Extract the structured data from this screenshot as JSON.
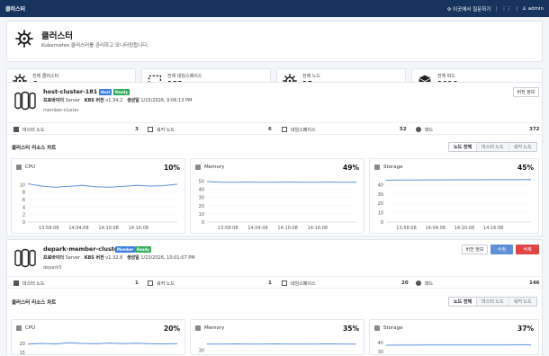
{
  "topbar": {
    "title": "클러스터",
    "help": "이곳에서 질문하기",
    "user": "admin"
  },
  "header": {
    "title": "클러스터",
    "subtitle": "Kubernetes 클러스터를 관리하고 모니터링합니다."
  },
  "stats": [
    {
      "label": "전체 클러스터",
      "value": "6",
      "icon": "helm-wheel-icon"
    },
    {
      "label": "전체 네임스페이스",
      "value": "133",
      "icon": "namespace-dashed-box-icon"
    },
    {
      "label": "전체 노드",
      "value": "15",
      "icon": "node-wheel-icon"
    },
    {
      "label": "전체 파드",
      "value": "1096",
      "icon": "pod-cube-icon"
    }
  ],
  "colors": {
    "topbar": "#17345f",
    "line": "#5b93d9",
    "host_badge": "#3b7ddd",
    "ready_badge": "#2fae5b",
    "member_badge": "#3b7ddd",
    "delete": "#e04545",
    "edit": "#5f8fd8"
  },
  "resource_labels": {
    "master": "마스터 노드",
    "worker": "워커 노드",
    "namespace": "네임스페이스",
    "pod": "파드"
  },
  "chart_section_title": "클러스터 리소스 차트",
  "chart_tabs": [
    "노드 전체",
    "마스터 노드",
    "워커 노드"
  ],
  "metric_labels": {
    "cpu": "CPU",
    "memory": "Memory",
    "storage": "Storage"
  },
  "clusters": [
    {
      "name": "host-cluster-181",
      "badges": [
        "Host",
        "Ready"
      ],
      "provider_label": "프로바이더",
      "provider": "Server",
      "version_label": "K8S 버전",
      "version": "v1.34.2",
      "created_label": "생성일",
      "created": "1/15/2026, 9:06:13 PM",
      "type": "member-cluster",
      "buttons": [
        "버전 정보"
      ],
      "resources": {
        "master": "3",
        "worker": "6",
        "namespace": "52",
        "pod": "372"
      },
      "cpu_pct": "10%",
      "mem_pct": "49%",
      "storage_pct": "45%"
    },
    {
      "name": "depark-member-cluster",
      "badges": [
        "Member",
        "Ready"
      ],
      "provider_label": "프로바이더",
      "provider": "Server",
      "version_label": "K8S 버전",
      "version": "v1.32.8",
      "created_label": "생성일",
      "created": "1/23/2026, 10:01:07 PM",
      "type": "depark5",
      "buttons": [
        "버전 정보",
        "수정",
        "삭제"
      ],
      "resources": {
        "master": "1",
        "worker": "1",
        "namespace": "20",
        "pod": "146"
      },
      "cpu_pct": "20%",
      "mem_pct": "35%",
      "storage_pct": "37%"
    }
  ],
  "chart_data": [
    {
      "type": "line",
      "title": "CPU",
      "x": [
        "13:58:08",
        "14:04:08",
        "14:10:08",
        "14:16:08"
      ],
      "yticks": [
        "0",
        "2",
        "4",
        "6",
        "8",
        "10"
      ],
      "ylim": [
        0,
        12
      ],
      "series": [
        {
          "values": [
            10.2,
            9.6,
            9.3,
            9.5,
            9.8,
            9.4,
            9.3,
            9.5,
            9.8,
            9.6,
            9.7,
            10.1
          ]
        }
      ]
    },
    {
      "type": "line",
      "title": "Memory",
      "x": [
        "13:58:08",
        "14:04:08",
        "14:10:08",
        "14:16:08"
      ],
      "yticks": [
        "0",
        "10",
        "20",
        "30",
        "40",
        "50"
      ],
      "ylim": [
        0,
        55
      ],
      "series": [
        {
          "values": [
            49.5,
            48.6,
            48.6,
            48.8,
            48.7,
            48.6,
            48.8,
            48.7,
            48.6,
            48.8,
            48.7,
            48.6
          ]
        }
      ]
    },
    {
      "type": "line",
      "title": "Storage",
      "x": [
        "13:58:08",
        "14:04:08",
        "14:10:08",
        "14:16:08"
      ],
      "yticks": [
        "0",
        "10",
        "20",
        "30",
        "40"
      ],
      "ylim": [
        0,
        48
      ],
      "series": [
        {
          "values": [
            44.6,
            44.8,
            44.9,
            45.0,
            45.0,
            45.1,
            45.1,
            45.1,
            45.2,
            45.2,
            45.2,
            45.3
          ]
        }
      ]
    },
    {
      "type": "line",
      "title": "CPU",
      "yticks": [
        "15",
        "20"
      ],
      "ylim": [
        13,
        23
      ],
      "series": [
        {
          "values": [
            19.6,
            20.0,
            19.7,
            20.4,
            20.0,
            19.8,
            20.2,
            19.9,
            20.1,
            19.8,
            19.7,
            19.9
          ]
        }
      ]
    },
    {
      "type": "line",
      "title": "Memory",
      "yticks": [
        "30"
      ],
      "ylim": [
        25,
        40
      ],
      "series": [
        {
          "values": [
            35.0,
            35.0,
            35.1,
            35.0,
            35.0,
            35.1,
            35.0,
            35.0,
            35.0,
            35.1,
            35.0,
            35.0
          ]
        }
      ]
    },
    {
      "type": "line",
      "title": "Storage",
      "yticks": [
        "30",
        "40"
      ],
      "ylim": [
        25,
        45
      ],
      "series": [
        {
          "values": [
            37.0,
            37.1,
            37.1,
            37.2,
            37.2,
            37.2,
            37.3,
            37.3,
            37.3,
            37.3,
            37.4,
            37.4
          ]
        }
      ]
    }
  ]
}
